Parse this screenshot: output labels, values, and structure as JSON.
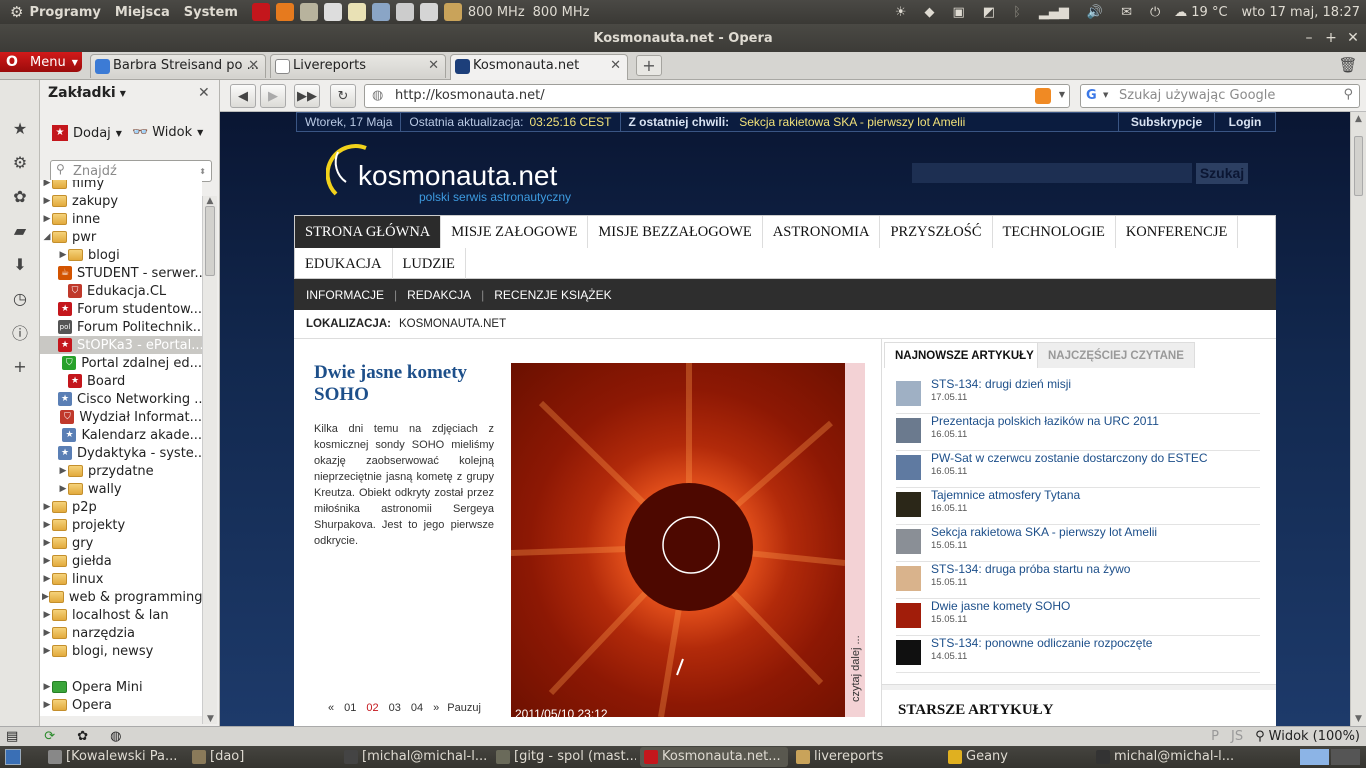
{
  "top_panel": {
    "menus": [
      "Programy",
      "Miejsca",
      "System"
    ],
    "cpu_freq": [
      "800 MHz",
      "800 MHz"
    ],
    "weather": "19 °C",
    "clock": "wto 17 maj, 18:27"
  },
  "window": {
    "title": "Kosmonauta.net - Opera"
  },
  "tabs": {
    "menu_label": "Menu",
    "items": [
      {
        "label": "Barbra Streisand po ..."
      },
      {
        "label": "Livereports"
      },
      {
        "label": "Kosmonauta.net"
      }
    ]
  },
  "sidebar": {
    "title": "Zakładki",
    "add_label": "Dodaj",
    "view_label": "Widok",
    "search_placeholder": "Znajdź",
    "items": [
      {
        "label": "filmy",
        "type": "folder",
        "indent": 0
      },
      {
        "label": "zakupy",
        "type": "folder",
        "indent": 0
      },
      {
        "label": "inne",
        "type": "folder",
        "indent": 0
      },
      {
        "label": "pwr",
        "type": "folder-open",
        "indent": 0
      },
      {
        "label": "blogi",
        "type": "folder",
        "indent": 1
      },
      {
        "label": "STUDENT - serwer...",
        "type": "java",
        "indent": 1
      },
      {
        "label": "Edukacja.CL",
        "type": "shield",
        "indent": 1
      },
      {
        "label": "Forum studentow...",
        "type": "star",
        "indent": 1
      },
      {
        "label": "Forum Politechnik...",
        "type": "pol",
        "indent": 1
      },
      {
        "label": "StOPKa3 - ePortal...",
        "type": "star",
        "indent": 1
      },
      {
        "label": "Portal zdalnej ed...",
        "type": "green",
        "indent": 1
      },
      {
        "label": "Board",
        "type": "star",
        "indent": 1
      },
      {
        "label": "Cisco Networking ...",
        "type": "blue",
        "indent": 1
      },
      {
        "label": "Wydział Informat...",
        "type": "shield",
        "indent": 1
      },
      {
        "label": "Kalendarz akade...",
        "type": "blue",
        "indent": 1
      },
      {
        "label": "Dydaktyka - syste...",
        "type": "blue",
        "indent": 1
      },
      {
        "label": "przydatne",
        "type": "folder",
        "indent": 1
      },
      {
        "label": "wally",
        "type": "folder",
        "indent": 1
      },
      {
        "label": "p2p",
        "type": "folder",
        "indent": 0
      },
      {
        "label": "projekty",
        "type": "folder",
        "indent": 0
      },
      {
        "label": "gry",
        "type": "folder",
        "indent": 0
      },
      {
        "label": "giełda",
        "type": "folder",
        "indent": 0
      },
      {
        "label": "linux",
        "type": "folder",
        "indent": 0
      },
      {
        "label": "web & programming",
        "type": "folder",
        "indent": 0
      },
      {
        "label": "localhost & lan",
        "type": "folder",
        "indent": 0
      },
      {
        "label": "narzędzia",
        "type": "folder",
        "indent": 0
      },
      {
        "label": "blogi, newsy",
        "type": "folder",
        "indent": 0
      },
      {
        "label": "",
        "type": "spacer",
        "indent": 0
      },
      {
        "label": "Opera Mini",
        "type": "folder-green",
        "indent": 0
      },
      {
        "label": "Opera",
        "type": "folder",
        "indent": 0
      }
    ]
  },
  "address_bar": {
    "url": "http://kosmonauta.net/",
    "search_placeholder": "Szukaj używając Google"
  },
  "site": {
    "date": "Wtorek, 17 Maja",
    "last_update_label": "Ostatnia aktualizacja:",
    "last_update_time": "03:25:16 CEST",
    "breaking_label": "Z ostatniej chwili:",
    "breaking_text": "Sekcja rakietowa SKA - pierwszy lot Amelii",
    "subscribe": "Subskrypcje",
    "login": "Login",
    "logo_name": "kosmonauta.net",
    "logo_tagline": "polski serwis astronautyczny",
    "search_button": "Szukaj",
    "nav": [
      "STRONA GŁÓWNA",
      "MISJE ZAŁOGOWE",
      "MISJE BEZZAŁOGOWE",
      "ASTRONOMIA",
      "PRZYSZŁOŚĆ",
      "TECHNOLOGIE",
      "KONFERENCJE",
      "EDUKACJA",
      "LUDZIE"
    ],
    "subnav": [
      "INFORMACJE",
      "REDAKCJA",
      "RECENZJE KSIĄŻEK"
    ],
    "location_label": "LOKALIZACJA:",
    "location_value": "KOSMONAUTA.NET",
    "featured": {
      "title": "Dwie jasne komety SOHO",
      "description": "Kilka dni temu na zdjęciach z kosmicznej sondy SOHO mieliśmy okazję zaobserwować kolejną nieprzeciętnie jasną kometę z grupy Kreutza. Obiekt odkryty został przez miłośnika astronomii Sergeya Shurpakova. Jest to jego pierwsze odkrycie.",
      "image_timestamp": "2011/05/10 23:12",
      "read_more": "czytaj dalej ...",
      "pager": [
        "«",
        "01",
        "02",
        "03",
        "04",
        "»",
        "Pauzuj"
      ],
      "active_page": "02"
    },
    "tabs": [
      "NAJNOWSZE ARTYKUŁY",
      "NAJCZĘŚCIEJ CZYTANE"
    ],
    "articles": [
      {
        "title": "STS-134: drugi dzień misji",
        "date": "17.05.11"
      },
      {
        "title": "Prezentacja polskich łazików na URC 2011",
        "date": "16.05.11"
      },
      {
        "title": "PW-Sat w czerwcu zostanie dostarczony do ESTEC",
        "date": "16.05.11"
      },
      {
        "title": "Tajemnice atmosfery Tytana",
        "date": "16.05.11"
      },
      {
        "title": "Sekcja rakietowa SKA - pierwszy lot Amelii",
        "date": "15.05.11"
      },
      {
        "title": "STS-134: druga próba startu na żywo",
        "date": "15.05.11"
      },
      {
        "title": "Dwie jasne komety SOHO",
        "date": "15.05.11"
      },
      {
        "title": "STS-134: ponowne odliczanie rozpoczęte",
        "date": "14.05.11"
      }
    ],
    "older_heading": "STARSZE ARTYKUŁY"
  },
  "status_bar": {
    "zoom": "Widok (100%)"
  },
  "taskbar": {
    "items": [
      {
        "label": "[Kowalewski Pa...",
        "active": false
      },
      {
        "label": "[dao]",
        "active": false
      },
      {
        "label": "[michal@michal-l...",
        "active": false
      },
      {
        "label": "[gitg - spol (mast...",
        "active": false
      },
      {
        "label": "Kosmonauta.net...",
        "active": true
      },
      {
        "label": "livereports",
        "active": false
      },
      {
        "label": "Geany",
        "active": false
      },
      {
        "label": "michal@michal-l...",
        "active": false
      }
    ]
  }
}
